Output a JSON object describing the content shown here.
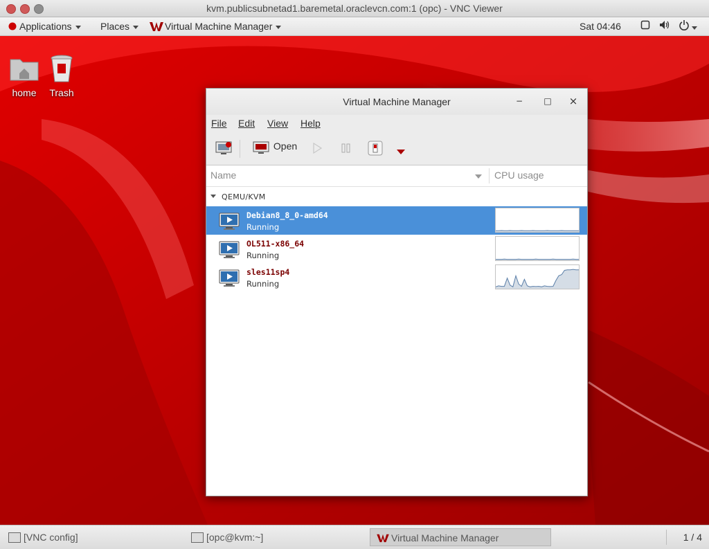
{
  "vnc_window": {
    "title": "kvm.publicsubnetad1.baremetal.oraclevcn.com:1 (opc) - VNC Viewer"
  },
  "top_panel": {
    "applications": "Applications",
    "places": "Places",
    "app_name": "Virtual Machine Manager",
    "clock": "Sat 04:46",
    "icons": [
      "screen-icon",
      "volume-icon",
      "power-icon"
    ]
  },
  "desktop": {
    "icons": [
      {
        "label": "home",
        "icon": "home-folder-icon"
      },
      {
        "label": "Trash",
        "icon": "trash-icon"
      }
    ]
  },
  "vmm": {
    "title": "Virtual Machine Manager",
    "menu": [
      "File",
      "Edit",
      "View",
      "Help"
    ],
    "toolbar": {
      "open_label": "Open",
      "buttons": [
        "new-vm-icon",
        "open-icon",
        "run-icon",
        "pause-icon",
        "shutdown-icon",
        "shutdown-menu-icon"
      ]
    },
    "columns": {
      "name": "Name",
      "cpu": "CPU usage"
    },
    "group": "QEMU/KVM",
    "vms": [
      {
        "name": "Debian8_8_0-amd64",
        "status": "Running",
        "selected": true,
        "cpu": [
          0.05,
          0.05,
          0.06,
          0.05,
          0.05,
          0.06,
          0.05,
          0.05,
          0.05,
          0.06,
          0.05,
          0.05,
          0.05,
          0.06,
          0.05,
          0.05,
          0.05,
          0.05,
          0.06,
          0.05,
          0.05,
          0.05,
          0.05,
          0.06,
          0.05,
          0.05,
          0.05,
          0.05,
          0.05,
          0.05
        ]
      },
      {
        "name": "OL511-x86_64",
        "status": "Running",
        "selected": false,
        "cpu": [
          0.04,
          0.04,
          0.04,
          0.05,
          0.04,
          0.04,
          0.04,
          0.04,
          0.05,
          0.04,
          0.04,
          0.04,
          0.04,
          0.04,
          0.05,
          0.04,
          0.04,
          0.04,
          0.04,
          0.04,
          0.05,
          0.04,
          0.04,
          0.04,
          0.04,
          0.04,
          0.04,
          0.05,
          0.04,
          0.04
        ]
      },
      {
        "name": "sles11sp4",
        "status": "Running",
        "selected": false,
        "cpu": [
          0.08,
          0.12,
          0.1,
          0.1,
          0.45,
          0.15,
          0.08,
          0.55,
          0.2,
          0.1,
          0.4,
          0.12,
          0.08,
          0.1,
          0.09,
          0.1,
          0.08,
          0.12,
          0.1,
          0.09,
          0.1,
          0.35,
          0.55,
          0.6,
          0.78,
          0.8,
          0.8,
          0.82,
          0.8,
          0.8
        ]
      }
    ]
  },
  "taskbar": {
    "items": [
      {
        "label": "[VNC config]",
        "active": false
      },
      {
        "label": "[opc@kvm:~]",
        "active": false
      },
      {
        "label": "Virtual Machine Manager",
        "active": true
      }
    ],
    "workspace": "1 / 4"
  },
  "colors": {
    "selection": "#4a90d9",
    "vm_name": "#7a0000",
    "wallpaper_red": "#c60000"
  }
}
